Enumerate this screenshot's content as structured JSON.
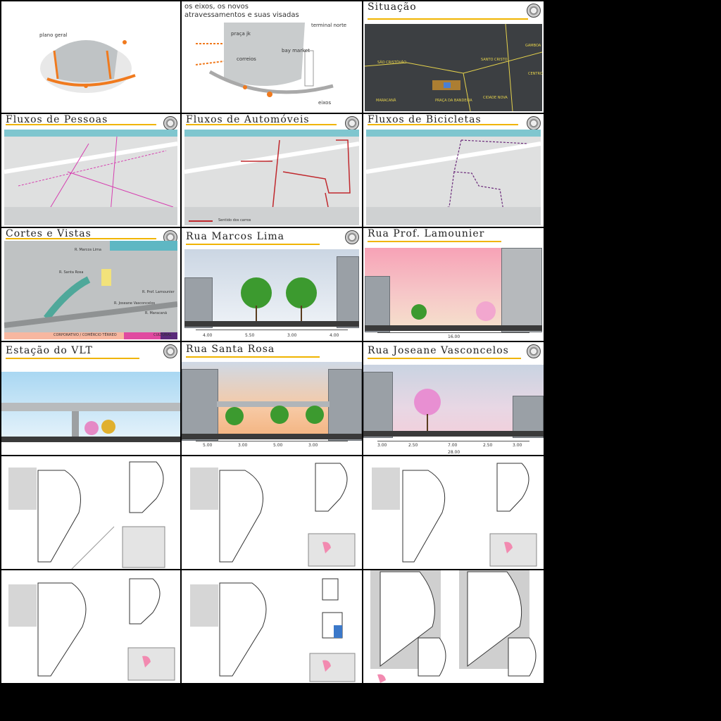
{
  "panels": {
    "p1": {
      "label": "plano geral"
    },
    "p2": {
      "title_line1": "os eixos, os novos",
      "title_line2": "atravessamentos e suas visadas",
      "labels": [
        "praça jk",
        "correios",
        "bay market",
        "terminal norte",
        "eixos"
      ]
    },
    "p3": {
      "title": "Situação",
      "places": [
        "SÃO CRISTÓVÃO",
        "SANTO CRISTO",
        "GAMBOA",
        "CENTRO",
        "MARACANÃ",
        "PRAÇA DA BANDEIRA",
        "CIDADE NOVA"
      ]
    },
    "p4": {
      "title": "Fluxos de Pessoas"
    },
    "p5": {
      "title": "Fluxos de Automóveis",
      "legend": "Sentido dos carros"
    },
    "p6": {
      "title": "Fluxos de Bicicletas"
    },
    "p7": {
      "title": "Cortes e Vistas",
      "legend_items": [
        "CORPORATIVO / COMÉRCIO TÉRREO",
        "CULTURAL"
      ],
      "cuts": [
        "R. Marcos Lima",
        "R. Santa Rosa",
        "R. Prof. Lamounier",
        "R. Joseane Vasconcelos",
        "R. Maracanã"
      ]
    },
    "p8": {
      "title": "Rua Marcos Lima",
      "dims": [
        "4.00",
        "5.50",
        "3.00",
        "4.00"
      ]
    },
    "p9": {
      "title": "Rua Prof. Lamounier",
      "dims": [
        "16.00"
      ]
    },
    "p10": {
      "title": "Estação do VLT"
    },
    "p11": {
      "title": "Rua Santa Rosa",
      "dims": [
        "5.00",
        "3.00",
        "5.00",
        "3.00"
      ]
    },
    "p12": {
      "title": "Rua Joseane Vasconcelos",
      "dims": [
        "3.00",
        "2.50",
        "7.00",
        "2.50",
        "3.00",
        "28.00"
      ]
    }
  },
  "colors": {
    "accent": "#f0b400",
    "arrow_orange": "#f07a1e",
    "arrow_red": "#c0282d",
    "magenta": "#d63fb0",
    "purple_dash": "#6b2a7a",
    "bg": "#000000"
  }
}
